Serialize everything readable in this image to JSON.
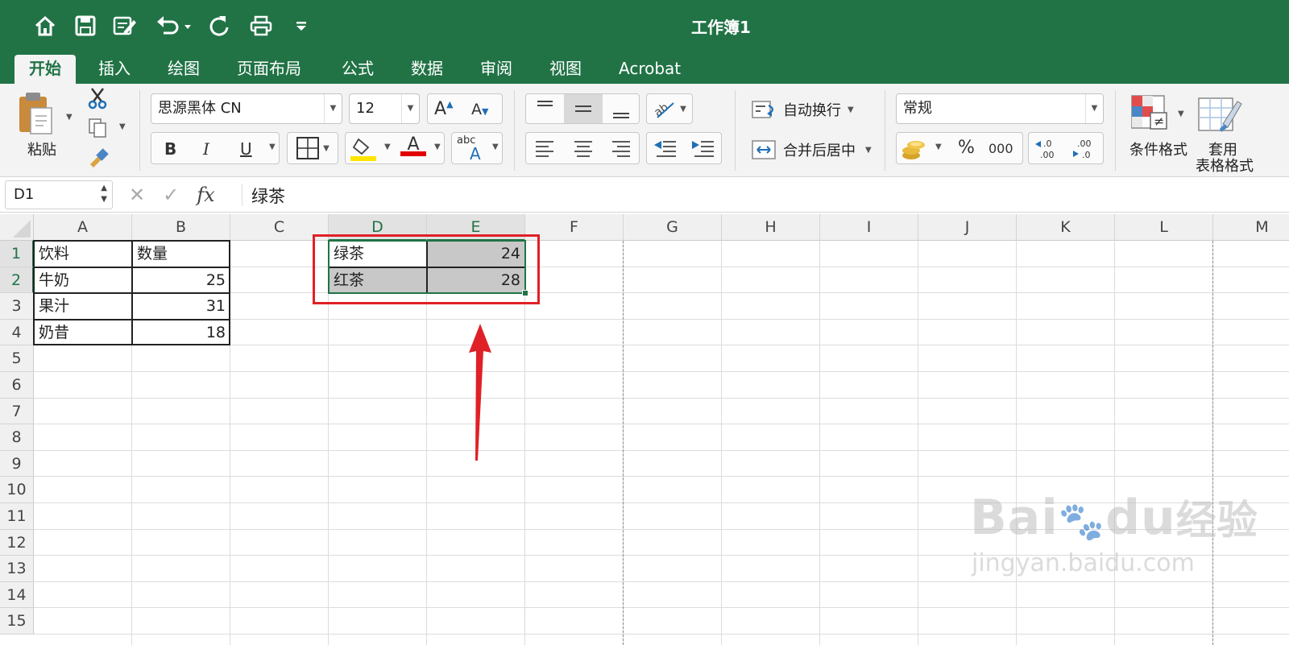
{
  "window": {
    "title": "工作簿1"
  },
  "tabs": [
    {
      "label": "开始",
      "active": true
    },
    {
      "label": "插入"
    },
    {
      "label": "绘图"
    },
    {
      "label": "页面布局"
    },
    {
      "label": "公式"
    },
    {
      "label": "数据"
    },
    {
      "label": "审阅"
    },
    {
      "label": "视图"
    },
    {
      "label": "Acrobat"
    }
  ],
  "ribbon": {
    "paste_label": "粘贴",
    "font_name": "思源黑体 CN",
    "font_size": "12",
    "bold": "B",
    "italic": "I",
    "underline": "U",
    "grow_font": "A",
    "shrink_font": "A",
    "font_color_letter": "A",
    "highlight_color": "#ffe600",
    "font_color": "#e00000",
    "wrap_text": "自动换行",
    "merge_center": "合并后居中",
    "number_format": "常规",
    "percent": "%",
    "thousands": "000",
    "conditional_format": "条件格式",
    "table_format_line1": "套用",
    "table_format_line2": "表格格式",
    "abc_label": "abc"
  },
  "formula_bar": {
    "name_box": "D1",
    "fx": "fx",
    "value": "绿茶"
  },
  "columns": [
    "A",
    "B",
    "C",
    "D",
    "E",
    "F",
    "G",
    "H",
    "I",
    "J",
    "K",
    "L",
    "M"
  ],
  "rows": [
    "1",
    "2",
    "3",
    "4",
    "5",
    "6",
    "7",
    "8",
    "9",
    "10",
    "11",
    "12",
    "13",
    "14",
    "15"
  ],
  "cells": {
    "A1": "饮料",
    "B1": "数量",
    "A2": "牛奶",
    "B2": "25",
    "A3": "果汁",
    "B3": "31",
    "A4": "奶昔",
    "B4": "18",
    "D1": "绿茶",
    "E1": "24",
    "D2": "红茶",
    "E2": "28"
  },
  "selection": {
    "range": "D1:E2",
    "active_cell": "D1"
  },
  "colors": {
    "accent": "#217346",
    "annotation": "#e02027"
  },
  "watermark": {
    "brand": "Bai",
    "brand_tail": "du",
    "suffix": "经验",
    "url": "jingyan.baidu.com"
  }
}
